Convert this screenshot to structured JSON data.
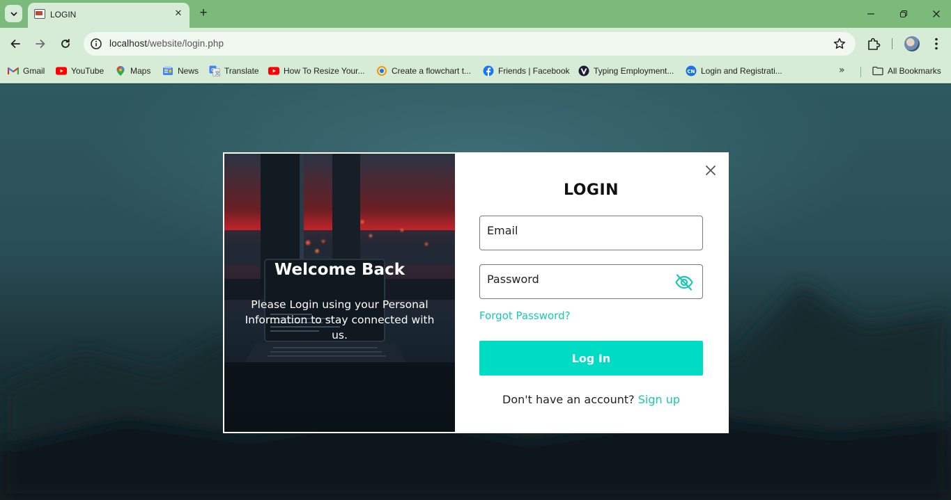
{
  "browser": {
    "tab": {
      "title": "LOGIN"
    },
    "address": {
      "host": "localhost",
      "path": "/website/login.php"
    },
    "bookmarks": [
      {
        "label": "Gmail",
        "icon": "gmail-icon"
      },
      {
        "label": "YouTube",
        "icon": "youtube-icon"
      },
      {
        "label": "Maps",
        "icon": "maps-icon"
      },
      {
        "label": "News",
        "icon": "news-icon"
      },
      {
        "label": "Translate",
        "icon": "translate-icon"
      },
      {
        "label": "How To Resize Your...",
        "icon": "youtube-icon"
      },
      {
        "label": "Create a flowchart t...",
        "icon": "flowchart-icon"
      },
      {
        "label": "Friends | Facebook",
        "icon": "facebook-icon"
      },
      {
        "label": "Typing Employment...",
        "icon": "typing-icon"
      },
      {
        "label": "Login and Registrati...",
        "icon": "codenotes-icon"
      }
    ],
    "all_bookmarks_label": "All Bookmarks"
  },
  "modal": {
    "welcome_title": "Welcome Back",
    "welcome_text": "Please Login using your Personal Information to stay connected with us.",
    "login_title": "LOGIN",
    "email_placeholder": "Email",
    "password_placeholder": "Password",
    "forgot_label": "Forgot Password?",
    "login_button": "Log In",
    "signup_prompt": "Don't have an account?",
    "signup_link": "Sign up"
  },
  "colors": {
    "accent": "#00dcc4",
    "link": "#16c9b4",
    "chrome_frame": "#7cba7c",
    "chrome_toolbar": "#d7ecd6"
  }
}
